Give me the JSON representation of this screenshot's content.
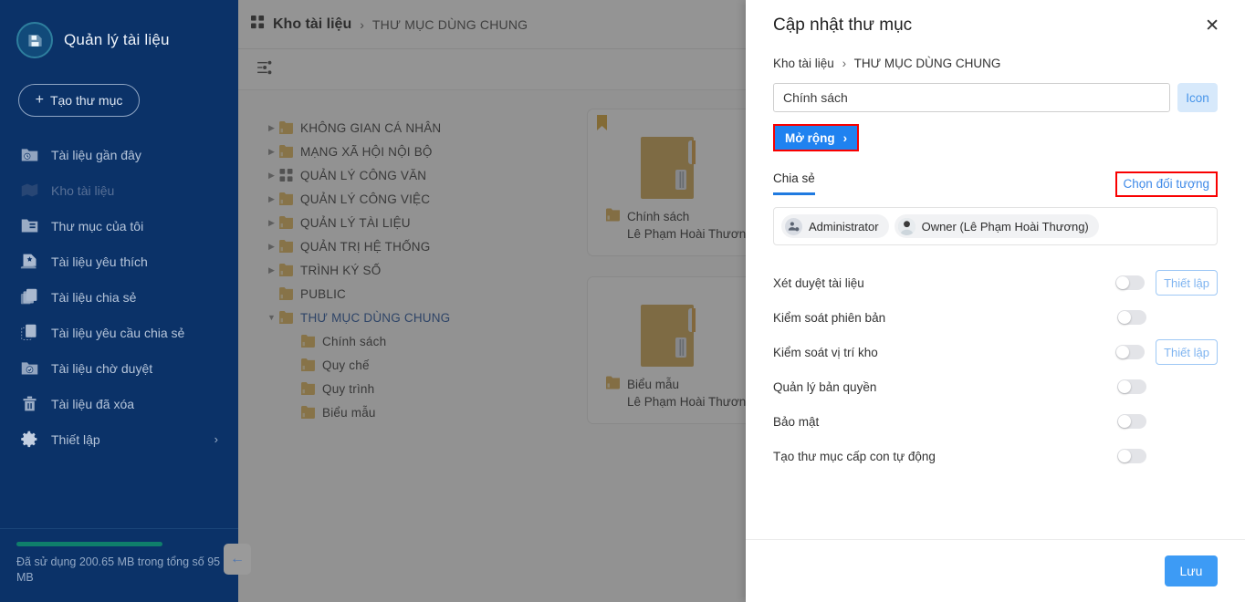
{
  "sidebar": {
    "brand": {
      "title": "Quản lý tài liệu",
      "logo_icon": "folder-save-icon"
    },
    "create_button": {
      "label": "Tạo thư mục",
      "icon": "plus-icon"
    },
    "items": [
      {
        "label": "Tài liệu gần đây",
        "icon": "recent-folder-icon",
        "active": false
      },
      {
        "label": "Kho tài liệu",
        "icon": "repository-icon",
        "active": true
      },
      {
        "label": "Thư mục của tôi",
        "icon": "my-folder-icon",
        "active": false
      },
      {
        "label": "Tài liệu yêu thích",
        "icon": "favorite-doc-icon",
        "active": false
      },
      {
        "label": "Tài liệu chia sẻ",
        "icon": "shared-doc-icon",
        "active": false
      },
      {
        "label": "Tài liệu yêu cầu chia sẻ",
        "icon": "share-request-icon",
        "active": false
      },
      {
        "label": "Tài liệu chờ duyệt",
        "icon": "pending-approval-icon",
        "active": false
      },
      {
        "label": "Tài liệu đã xóa",
        "icon": "trash-icon",
        "active": false
      },
      {
        "label": "Thiết lập",
        "icon": "gear-icon",
        "active": false,
        "chevron": "›"
      }
    ],
    "storage": {
      "text": "Đã sử dụng 200.65 MB trong tổng số 95 MB",
      "bar_color": "#0f7f6b",
      "percent": 100
    },
    "collapse_button": {
      "icon": "chevron-left-icon",
      "glyph": "←"
    }
  },
  "main": {
    "breadcrumb": {
      "icon": "grid-icon",
      "root": "Kho tài liệu",
      "separator": "›",
      "leaf": "THƯ MỤC DÙNG CHUNG"
    },
    "toolbar": {
      "filter_icon": "filter-settings-icon"
    },
    "tree": [
      {
        "label": "KHÔNG GIAN CÁ NHÂN",
        "level": 1,
        "expandable": true,
        "expanded": false,
        "icon": "folder-icon",
        "selected": false
      },
      {
        "label": "MẠNG XÃ HỘI NỘI BỘ",
        "level": 1,
        "expandable": true,
        "expanded": false,
        "icon": "folder-icon",
        "selected": false
      },
      {
        "label": "QUẢN LÝ CÔNG VĂN",
        "level": 1,
        "expandable": true,
        "expanded": false,
        "icon": "grid-icon",
        "selected": false
      },
      {
        "label": "QUẢN LÝ CÔNG VIỆC",
        "level": 1,
        "expandable": true,
        "expanded": false,
        "icon": "folder-icon",
        "selected": false
      },
      {
        "label": "QUẢN LÝ TÀI LIỆU",
        "level": 1,
        "expandable": true,
        "expanded": false,
        "icon": "folder-icon",
        "selected": false
      },
      {
        "label": "QUẢN TRỊ HỆ THỐNG",
        "level": 1,
        "expandable": true,
        "expanded": false,
        "icon": "folder-icon",
        "selected": false
      },
      {
        "label": "TRÌNH KÝ SỐ",
        "level": 1,
        "expandable": true,
        "expanded": false,
        "icon": "folder-icon",
        "selected": false
      },
      {
        "label": "PUBLIC",
        "level": 1,
        "expandable": false,
        "expanded": false,
        "icon": "folder-icon",
        "selected": false
      },
      {
        "label": "THƯ MỤC DÙNG CHUNG",
        "level": 1,
        "expandable": true,
        "expanded": true,
        "icon": "folder-icon",
        "selected": true
      },
      {
        "label": "Chính sách",
        "level": 2,
        "expandable": false,
        "expanded": false,
        "icon": "folder-icon",
        "selected": false
      },
      {
        "label": "Quy chế",
        "level": 2,
        "expandable": false,
        "expanded": false,
        "icon": "folder-icon",
        "selected": false
      },
      {
        "label": "Quy trình",
        "level": 2,
        "expandable": false,
        "expanded": false,
        "icon": "folder-icon",
        "selected": false
      },
      {
        "label": "Biểu mẫu",
        "level": 2,
        "expandable": false,
        "expanded": false,
        "icon": "folder-icon",
        "selected": false
      }
    ],
    "cards": [
      {
        "name": "Chính sách",
        "owner": "Lê Phạm Hoài Thương",
        "bookmarked": true
      },
      {
        "name": "Biểu mẫu",
        "owner": "Lê Phạm Hoài Thương",
        "bookmarked": false
      }
    ]
  },
  "panel": {
    "title": "Cập nhật thư mục",
    "close_icon": "close-icon",
    "breadcrumb": {
      "root": "Kho tài liệu",
      "separator": "›",
      "leaf": "THƯ MỤC DÙNG CHUNG"
    },
    "name_field": {
      "value": "Chính sách",
      "placeholder": "Tên thư mục"
    },
    "icon_button": {
      "label": "Icon"
    },
    "expand_button": {
      "label": "Mở rộng",
      "chevron": "›",
      "highlighted": true,
      "bg": "#1f82f0",
      "highlight_color": "#f90000"
    },
    "tabs": [
      {
        "label": "Chia sẻ",
        "active": true
      }
    ],
    "pick_link": {
      "label": "Chọn đối tượng",
      "highlighted": true,
      "color": "#3f8ae8",
      "highlight_color": "#f90000"
    },
    "chips": [
      {
        "label": "Administrator",
        "icon": "user-gear-icon"
      },
      {
        "label": "Owner (Lê Phạm Hoài Thương)",
        "icon": "avatar-icon"
      }
    ],
    "settings": [
      {
        "label": "Xét duyệt tài liệu",
        "enabled": false,
        "setup_label": "Thiết lập",
        "has_setup": true
      },
      {
        "label": "Kiểm soát phiên bản",
        "enabled": false,
        "setup_label": "",
        "has_setup": false
      },
      {
        "label": "Kiểm soát vị trí kho",
        "enabled": false,
        "setup_label": "Thiết lập",
        "has_setup": true
      },
      {
        "label": "Quản lý bản quyền",
        "enabled": false,
        "setup_label": "",
        "has_setup": false
      },
      {
        "label": "Bảo mật",
        "enabled": false,
        "setup_label": "",
        "has_setup": false
      },
      {
        "label": "Tạo thư mục cấp con tự động",
        "enabled": false,
        "setup_label": "",
        "has_setup": false
      }
    ],
    "save_button": {
      "label": "Lưu",
      "bg": "#3d9bf5"
    }
  }
}
